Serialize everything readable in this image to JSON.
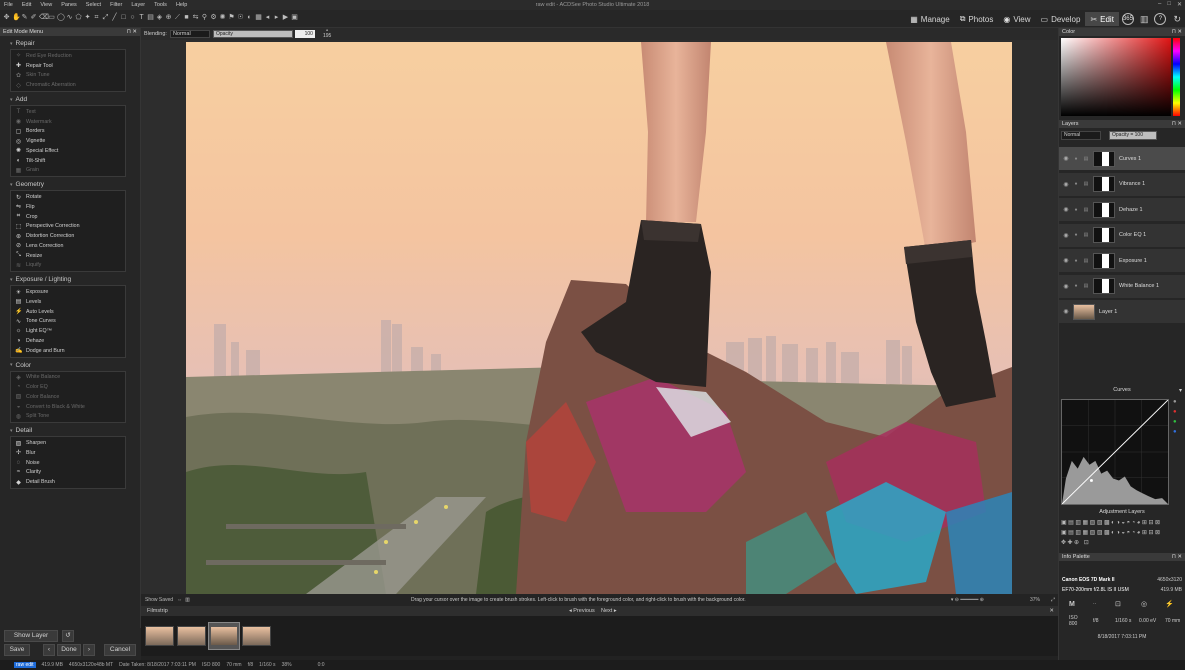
{
  "app": {
    "title": "raw edit - ACDSee Photo Studio Ultimate 2018",
    "menu": [
      "File",
      "Edit",
      "View",
      "Panes",
      "Select",
      "Filter",
      "Layer",
      "Tools",
      "Help"
    ],
    "modes": [
      {
        "label": "Manage",
        "icon": "grid-icon"
      },
      {
        "label": "Photos",
        "icon": "photos-icon"
      },
      {
        "label": "View",
        "icon": "eye-icon"
      },
      {
        "label": "Develop",
        "icon": "develop-icon"
      },
      {
        "label": "Edit",
        "icon": "edit-icon",
        "active": true
      }
    ]
  },
  "options_bar": {
    "blending_label": "Blending:",
    "blending_value": "Normal",
    "opacity_label": "Opacity",
    "opacity_value": "100",
    "brush_value": "195"
  },
  "left_panel": {
    "title": "Edit Mode Menu",
    "groups": [
      {
        "name": "Repair",
        "items": [
          {
            "label": "Red Eye Reduction",
            "enabled": false
          },
          {
            "label": "Repair Tool",
            "enabled": true
          },
          {
            "label": "Skin Tune",
            "enabled": false
          },
          {
            "label": "Chromatic Aberration",
            "enabled": false
          }
        ]
      },
      {
        "name": "Add",
        "items": [
          {
            "label": "Text",
            "enabled": false
          },
          {
            "label": "Watermark",
            "enabled": false
          },
          {
            "label": "Borders",
            "enabled": true
          },
          {
            "label": "Vignette",
            "enabled": true
          },
          {
            "label": "Special Effect",
            "enabled": true
          },
          {
            "label": "Tilt-Shift",
            "enabled": true
          },
          {
            "label": "Grain",
            "enabled": false
          }
        ]
      },
      {
        "name": "Geometry",
        "items": [
          {
            "label": "Rotate",
            "enabled": true
          },
          {
            "label": "Flip",
            "enabled": true
          },
          {
            "label": "Crop",
            "enabled": true
          },
          {
            "label": "Perspective Correction",
            "enabled": true
          },
          {
            "label": "Distortion Correction",
            "enabled": true
          },
          {
            "label": "Lens Correction",
            "enabled": true
          },
          {
            "label": "Resize",
            "enabled": true
          },
          {
            "label": "Liquify",
            "enabled": false
          }
        ]
      },
      {
        "name": "Exposure / Lighting",
        "items": [
          {
            "label": "Exposure",
            "enabled": true
          },
          {
            "label": "Levels",
            "enabled": true
          },
          {
            "label": "Auto Levels",
            "enabled": true
          },
          {
            "label": "Tone Curves",
            "enabled": true
          },
          {
            "label": "Light EQ™",
            "enabled": true
          },
          {
            "label": "Dehaze",
            "enabled": true
          },
          {
            "label": "Dodge and Burn",
            "enabled": true
          }
        ]
      },
      {
        "name": "Color",
        "items": [
          {
            "label": "White Balance",
            "enabled": false
          },
          {
            "label": "Color EQ",
            "enabled": false
          },
          {
            "label": "Color Balance",
            "enabled": false
          },
          {
            "label": "Convert to Black & White",
            "enabled": false
          },
          {
            "label": "Split Tone",
            "enabled": false
          }
        ]
      },
      {
        "name": "Detail",
        "items": [
          {
            "label": "Sharpen",
            "enabled": true
          },
          {
            "label": "Blur",
            "enabled": true
          },
          {
            "label": "Noise",
            "enabled": true
          },
          {
            "label": "Clarity",
            "enabled": true
          },
          {
            "label": "Detail Brush",
            "enabled": true
          }
        ]
      }
    ],
    "show_layer_label": "Show Layer",
    "save_label": "Save",
    "done_label": "Done",
    "cancel_label": "Cancel"
  },
  "canvas": {
    "show_saved_label": "Show Saved",
    "hint": "Drag your cursor over the image to create brush strokes. Left-click to brush with the foreground color, and right-click to brush with the background color.",
    "zoom": "37%"
  },
  "filmstrip": {
    "title": "Filmstrip",
    "previous_label": "Previous",
    "next_label": "Next"
  },
  "status_bar": [
    "raw edit",
    "419.9 MB",
    "4650x3120x48b MT",
    "Date Taken: 8/18/2017 7:03:11 PM",
    "ISO 800",
    "70 mm",
    "f/8",
    "1/160 s",
    "38%",
    "0:0"
  ],
  "right_panel": {
    "color_title": "Color",
    "layers_title": "Layers",
    "layers_blend": "Normal",
    "layers_opacity": "Opacity = 100",
    "layers": [
      {
        "name": "Curves 1",
        "selected": true
      },
      {
        "name": "Vibrance 1",
        "selected": false
      },
      {
        "name": "Dehaze 1",
        "selected": false
      },
      {
        "name": "Color EQ 1",
        "selected": false
      },
      {
        "name": "Exposure 1",
        "selected": false
      },
      {
        "name": "White Balance 1",
        "selected": false
      },
      {
        "name": "Layer 1",
        "selected": false
      }
    ],
    "curves_title": "Curves",
    "adjustment_title": "Adjustment Layers",
    "info_title": "Info Palette",
    "camera": "Canon EOS 7D Mark II",
    "dims": "4650x3120",
    "lens": "EF70-200mm f/2.8L IS II USM",
    "size": "419.9 MB",
    "mode": "M",
    "iso_label": "ISO",
    "iso": "800",
    "aperture": "f/8",
    "shutter": "1/160 s",
    "ev": "0.00 eV",
    "focal": "70 mm",
    "date": "8/18/2017 7:03:11 PM"
  },
  "colors": {
    "accent": "#1e6bd8",
    "panel": "#262626",
    "selected": "#4b4b4b"
  }
}
